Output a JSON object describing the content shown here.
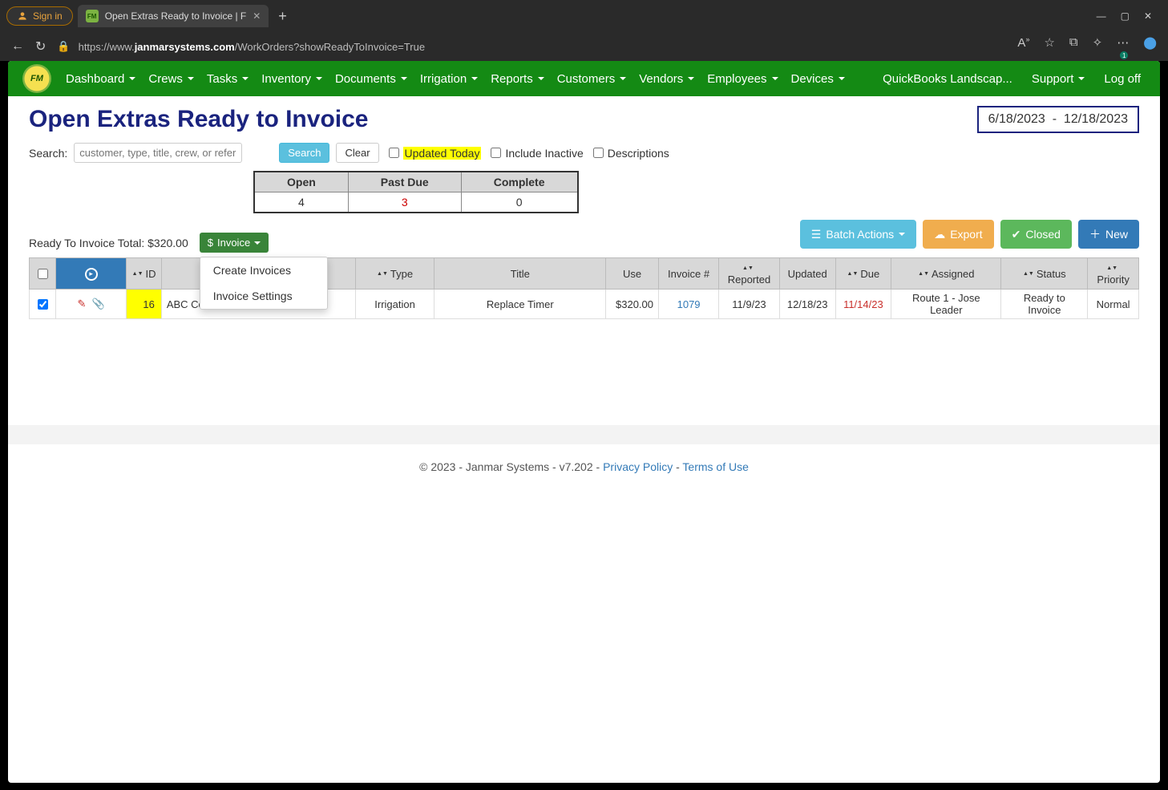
{
  "browser": {
    "sign_in": "Sign in",
    "tab_title": "Open Extras Ready to Invoice | F",
    "url_prefix": "https://",
    "url_host_plain": "www.",
    "url_host_bold": "janmarsystems.com",
    "url_path": "/WorkOrders?showReadyToInvoice=True"
  },
  "nav": {
    "items": [
      "Dashboard",
      "Crews",
      "Tasks",
      "Inventory",
      "Documents",
      "Irrigation",
      "Reports",
      "Customers",
      "Vendors",
      "Employees",
      "Devices"
    ],
    "right": [
      "QuickBooks Landscap...",
      "Support",
      "Log off"
    ]
  },
  "page_title": "Open Extras Ready to Invoice",
  "date_range": {
    "from": "6/18/2023",
    "sep": "-",
    "to": "12/18/2023"
  },
  "search": {
    "label": "Search:",
    "placeholder": "customer, type, title, crew, or reference",
    "btn_search": "Search",
    "btn_clear": "Clear",
    "chk_updated": "Updated Today",
    "chk_inactive": "Include Inactive",
    "chk_desc": "Descriptions"
  },
  "summary": {
    "headers": [
      "Open",
      "Past Due",
      "Complete"
    ],
    "values": [
      "4",
      "3",
      "0"
    ]
  },
  "actions": {
    "batch": "Batch Actions",
    "export": "Export",
    "closed": "Closed",
    "new": "New"
  },
  "ready_total": {
    "label": "Ready To Invoice Total:",
    "value": "$320.00"
  },
  "invoice_dd": {
    "label": "Invoice",
    "items": [
      "Create Invoices",
      "Invoice Settings"
    ]
  },
  "table": {
    "headers": [
      "",
      "",
      "ID",
      "",
      "Type",
      "Title",
      "Use",
      "Invoice #",
      "Reported",
      "Updated",
      "Due",
      "Assigned",
      "Status",
      "Priority"
    ],
    "row": {
      "id": "16",
      "customer": "ABC Co",
      "type": "Irrigation",
      "title": "Replace Timer",
      "use": "$320.00",
      "invoice": "1079",
      "reported": "11/9/23",
      "updated": "12/18/23",
      "due": "11/14/23",
      "assigned": "Route 1 - Jose Leader",
      "status": "Ready to Invoice",
      "priority": "Normal"
    }
  },
  "footer": {
    "copy": "© 2023 - Janmar Systems - v7.202 - ",
    "privacy": "Privacy Policy",
    "sep": " - ",
    "terms": "Terms of Use"
  }
}
